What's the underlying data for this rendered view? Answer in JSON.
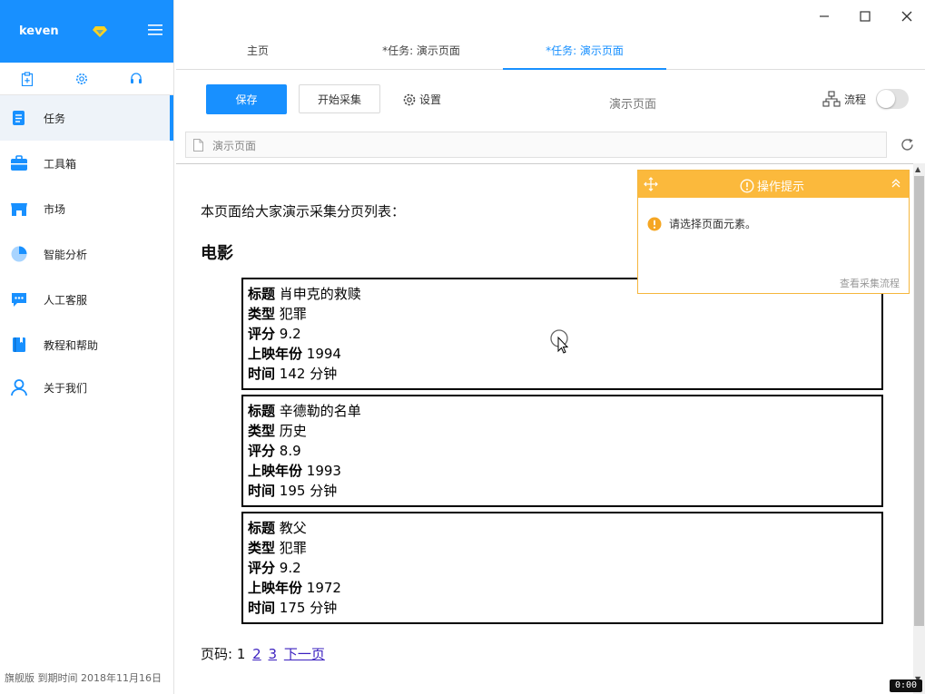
{
  "sidebar": {
    "user": "keven",
    "items": [
      {
        "label": "任务",
        "icon": "task-icon"
      },
      {
        "label": "工具箱",
        "icon": "toolbox-icon"
      },
      {
        "label": "市场",
        "icon": "store-icon"
      },
      {
        "label": "智能分析",
        "icon": "pie-chart-icon"
      },
      {
        "label": "人工客服",
        "icon": "chat-icon"
      },
      {
        "label": "教程和帮助",
        "icon": "book-icon"
      },
      {
        "label": "关于我们",
        "icon": "user-icon"
      }
    ],
    "active_index": 0,
    "footer": "旗舰版  到期时间 2018年11月16日"
  },
  "tabs": [
    {
      "label": "主页"
    },
    {
      "label": "*任务: 演示页面"
    },
    {
      "label": "*任务: 演示页面"
    }
  ],
  "toolbar": {
    "save_label": "保存",
    "start_label": "开始采集",
    "settings_label": "设置",
    "center_title": "演示页面",
    "flow_label": "流程"
  },
  "address": {
    "value": "演示页面"
  },
  "page": {
    "intro": "本页面给大家演示采集分页列表：",
    "heading": "电影",
    "field_labels": {
      "title": "标题",
      "type": "类型",
      "score": "评分",
      "year": "上映年份",
      "duration": "时间"
    },
    "movies": [
      {
        "title": "肖申克的救赎",
        "type": "犯罪",
        "score": "9.2",
        "year": "1994",
        "duration": "142 分钟"
      },
      {
        "title": "辛德勒的名单",
        "type": "历史",
        "score": "8.9",
        "year": "1993",
        "duration": "195 分钟"
      },
      {
        "title": "教父",
        "type": "犯罪",
        "score": "9.2",
        "year": "1972",
        "duration": "175 分钟"
      }
    ],
    "pager": {
      "label": "页码:",
      "current": "1",
      "pages": [
        "2",
        "3"
      ],
      "next": "下一页"
    }
  },
  "tip": {
    "title": "操作提示",
    "message": "请选择页面元素。",
    "footer": "查看采集流程"
  },
  "timer": "0:00",
  "colors": {
    "accent": "#1890ff",
    "tip_orange": "#fbb93c"
  }
}
